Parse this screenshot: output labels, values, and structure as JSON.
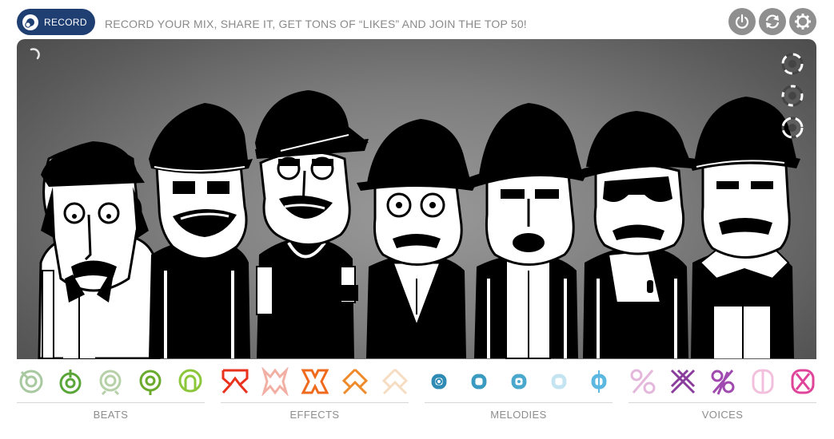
{
  "header": {
    "record_label": "RECORD",
    "tagline": "RECORD YOUR MIX, SHARE IT, GET TONS OF “LIKES” AND JOIN THE TOP 50!",
    "controls": [
      "power-icon",
      "refresh-icon",
      "settings-icon"
    ]
  },
  "stage": {
    "character_count": 7,
    "side_buttons": [
      "mute-icon",
      "solo-icon",
      "random-icon"
    ]
  },
  "palettes": [
    {
      "label": "BEATS",
      "icons": [
        "beat-icon-1",
        "beat-icon-2",
        "beat-icon-3",
        "beat-icon-4",
        "beat-icon-5"
      ],
      "colors": [
        "#a8c8a0",
        "#5aa63a",
        "#b6d0a8",
        "#6aaa2c",
        "#8cc63a"
      ]
    },
    {
      "label": "EFFECTS",
      "icons": [
        "effect-icon-1",
        "effect-icon-2",
        "effect-icon-3",
        "effect-icon-4",
        "effect-icon-5"
      ],
      "colors": [
        "#e8321e",
        "#f2b0a4",
        "#ef6a1c",
        "#ef8a2a",
        "#f6dcc0"
      ]
    },
    {
      "label": "MELODIES",
      "icons": [
        "melody-icon-1",
        "melody-icon-2",
        "melody-icon-3",
        "melody-icon-4",
        "melody-icon-5"
      ],
      "colors": [
        "#2f8ab4",
        "#3a9ac0",
        "#4aa8cc",
        "#c4e4f2",
        "#5cb8e0"
      ]
    },
    {
      "label": "VOICES",
      "icons": [
        "voice-icon-1",
        "voice-icon-2",
        "voice-icon-3",
        "voice-icon-4",
        "voice-icon-5"
      ],
      "colors": [
        "#e4b8dc",
        "#8a3c9c",
        "#a04ab0",
        "#f2c0dc",
        "#e0449a"
      ]
    }
  ]
}
